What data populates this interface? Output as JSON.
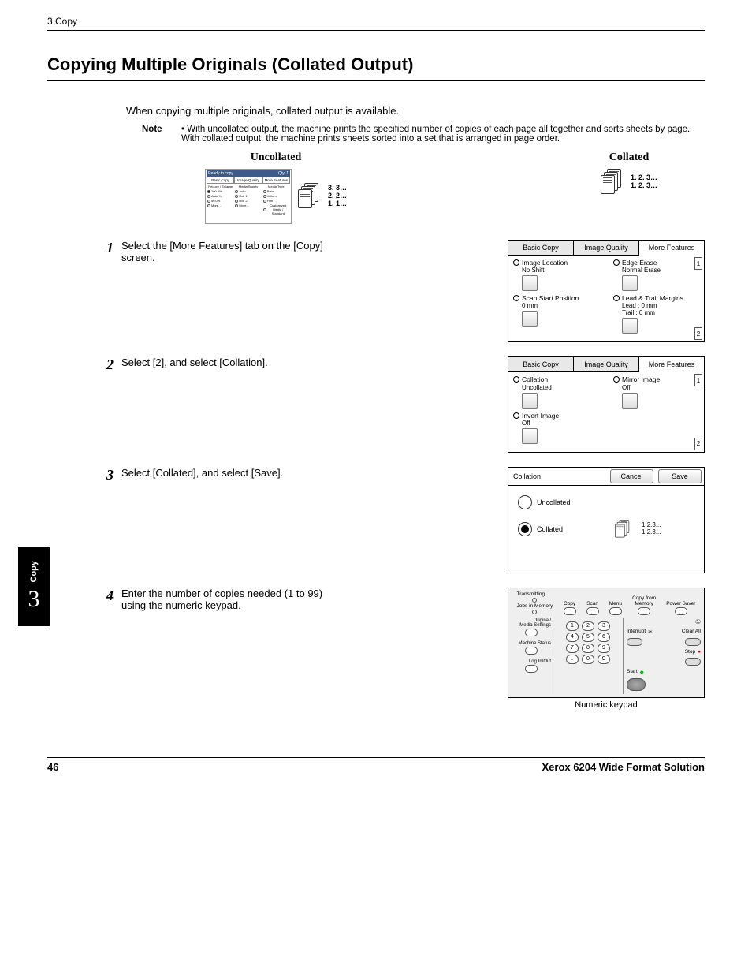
{
  "header": {
    "breadcrumb": "3 Copy"
  },
  "title": "Copying Multiple Originals (Collated Output)",
  "intro": "When copying multiple originals, collated output is available.",
  "note": {
    "label": "Note",
    "text": "• With uncollated output, the machine prints the specified number of copies of each page all together and sorts sheets by page. With collated output, the machine prints sheets sorted into a set that is arranged in page order."
  },
  "diagrams": {
    "uncollated": {
      "title": "Uncollated",
      "seq": [
        "3. 3…",
        "2. 2…",
        "1. 1…"
      ]
    },
    "collated": {
      "title": "Collated",
      "seq": [
        "1. 2. 3…",
        "1. 2. 3…"
      ]
    },
    "mini_screen": {
      "status": "Ready to copy",
      "qty_label": "Qty.",
      "qty_value": "1",
      "tabs": [
        "Basic Copy",
        "Image Quality",
        "More Features"
      ],
      "col_headers": [
        "Reduce / Enlarge",
        "Media Supply",
        "Media Type"
      ],
      "col1": [
        "100.0%",
        "Auto %",
        "50.0%",
        "More…"
      ],
      "col2": [
        "Auto",
        "Roll 1",
        "Roll 2",
        "More…"
      ],
      "col3": [
        "Bond",
        "Vellum",
        "Film",
        "Customized Media / Standard"
      ]
    }
  },
  "side_tab": {
    "label": "Copy",
    "chapter": "3"
  },
  "steps": {
    "s1": {
      "num": "1",
      "text": "Select the [More Features] tab on the [Copy] screen."
    },
    "s2": {
      "num": "2",
      "text": "Select [2], and select [Collation]."
    },
    "s3": {
      "num": "3",
      "text": "Select [Collated], and select [Save]."
    },
    "s4": {
      "num": "4",
      "text": "Enter the number of copies needed (1 to 99) using the numeric keypad."
    }
  },
  "screen1": {
    "tabs": [
      "Basic Copy",
      "Image Quality",
      "More Features"
    ],
    "opts": {
      "img_loc": {
        "label": "Image Location",
        "value": "No Shift"
      },
      "edge": {
        "label": "Edge Erase",
        "value": "Normal Erase"
      },
      "scan": {
        "label": "Scan Start Position",
        "value": "0 mm"
      },
      "margins": {
        "label": "Lead & Trail Margins",
        "lead": "Lead   : 0 mm",
        "trail": "Trail    : 0 mm"
      }
    },
    "page_up": "1",
    "page_down": "2"
  },
  "screen2": {
    "tabs": [
      "Basic Copy",
      "Image Quality",
      "More Features"
    ],
    "opts": {
      "collation": {
        "label": "Collation",
        "value": "Uncollated"
      },
      "mirror": {
        "label": "Mirror Image",
        "value": "Off"
      },
      "invert": {
        "label": "Invert Image",
        "value": "Off"
      }
    },
    "page_up": "1",
    "page_down": "2"
  },
  "screen3": {
    "title": "Collation",
    "cancel": "Cancel",
    "save": "Save",
    "opt_uncollated": "Uncollated",
    "opt_collated": "Collated",
    "seq": [
      "1.2.3...",
      "1.2.3..."
    ]
  },
  "keypad": {
    "top": {
      "copy_from_memory": "Copy from\nMemory",
      "transmitting": "Transmitting",
      "jobs_in_memory": "Jobs in Memory",
      "copy": "Copy",
      "scan": "Scan",
      "menu": "Menu",
      "power": "Power Saver"
    },
    "left": {
      "media": "Original/\nMedia Settings",
      "machine": "Machine Status",
      "log": "Log In/Out"
    },
    "keys": [
      [
        "1",
        "2",
        "3"
      ],
      [
        "4",
        "5",
        "6"
      ],
      [
        "7",
        "8",
        "9"
      ],
      [
        ".",
        "0",
        "C"
      ]
    ],
    "right": {
      "interrupt": "Interrupt",
      "clear_all": "Clear All",
      "stop": "Stop",
      "start": "Start"
    },
    "caption": "Numeric keypad"
  },
  "footer": {
    "page": "46",
    "product": "Xerox 6204 Wide Format Solution"
  }
}
